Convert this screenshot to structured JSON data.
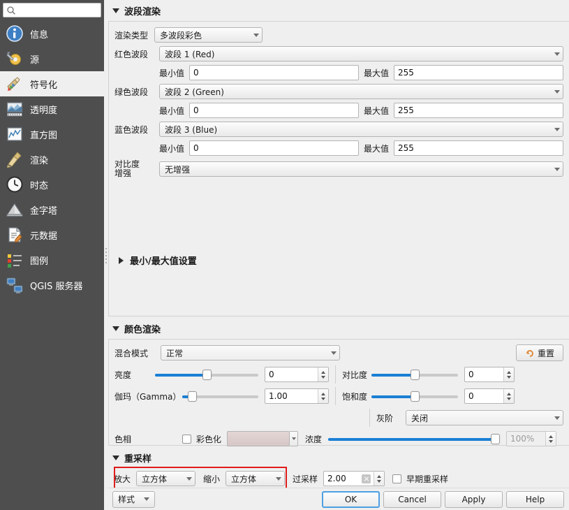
{
  "sidebar": {
    "search": {
      "value": "",
      "placeholder": "",
      "icon": "search-icon"
    },
    "items": [
      {
        "label": "信息",
        "icon": "info-icon",
        "selected": false
      },
      {
        "label": "源",
        "icon": "source-icon",
        "selected": false
      },
      {
        "label": "符号化",
        "icon": "symbology-icon",
        "selected": true
      },
      {
        "label": "透明度",
        "icon": "transparency-icon",
        "selected": false
      },
      {
        "label": "直方图",
        "icon": "histogram-icon",
        "selected": false
      },
      {
        "label": "渲染",
        "icon": "rendering-icon",
        "selected": false
      },
      {
        "label": "时态",
        "icon": "temporal-icon",
        "selected": false
      },
      {
        "label": "金字塔",
        "icon": "pyramids-icon",
        "selected": false
      },
      {
        "label": "元数据",
        "icon": "metadata-icon",
        "selected": false
      },
      {
        "label": "图例",
        "icon": "legend-icon",
        "selected": false
      },
      {
        "label": "QGIS 服务器",
        "icon": "qgis-server-icon",
        "selected": false
      }
    ]
  },
  "band_rendering": {
    "title": "波段渲染",
    "render_type": {
      "label": "渲染类型",
      "value": "多波段彩色"
    },
    "red": {
      "label": "红色波段",
      "value": "波段 1 (Red)",
      "min_label": "最小值",
      "min": "0",
      "max_label": "最大值",
      "max": "255"
    },
    "green": {
      "label": "绿色波段",
      "value": "波段 2 (Green)",
      "min_label": "最小值",
      "min": "0",
      "max_label": "最大值",
      "max": "255"
    },
    "blue": {
      "label": "蓝色波段",
      "value": "波段 3 (Blue)",
      "min_label": "最小值",
      "min": "0",
      "max_label": "最大值",
      "max": "255"
    },
    "contrast_enhancement": {
      "label": "对比度\n增强",
      "label_line1": "对比度",
      "label_line2": "增强",
      "value": "无增强"
    },
    "minmax_settings": {
      "label": "最小/最大值设置",
      "expanded": false
    }
  },
  "color_rendering": {
    "title": "颜色渲染",
    "blend_mode": {
      "label": "混合模式",
      "value": "正常"
    },
    "reset": {
      "label": "重置",
      "icon": "undo-icon",
      "color": "#e08a3c"
    },
    "brightness": {
      "label": "亮度",
      "value": "0",
      "percent": 50
    },
    "contrast": {
      "label": "对比度",
      "value": "0",
      "percent": 50
    },
    "gamma": {
      "label": "伽玛（Gamma）",
      "value": "1.00",
      "percent": 8
    },
    "saturation": {
      "label": "饱和度",
      "value": "0",
      "percent": 50
    },
    "grayscale": {
      "label": "灰阶",
      "value": "关闭"
    },
    "hue": {
      "label": "色相",
      "colorize_label": "彩色化",
      "colorize_checked": false,
      "strength_label": "浓度",
      "strength_value": "100%",
      "strength_percent": 100,
      "swatch_color": "#e3d6d5"
    }
  },
  "resampling": {
    "title": "重采样",
    "zoom_in": {
      "label": "放大",
      "value": "立方体"
    },
    "zoom_out": {
      "label": "缩小",
      "value": "立方体"
    },
    "oversampling": {
      "label": "过采样",
      "value": "2.00"
    },
    "early_resample": {
      "label": "早期重采样",
      "checked": false
    },
    "highlight_color": "#e01b1b"
  },
  "footer": {
    "style_button": "样式",
    "ok": "OK",
    "cancel": "Cancel",
    "apply": "Apply",
    "help": "Help"
  }
}
